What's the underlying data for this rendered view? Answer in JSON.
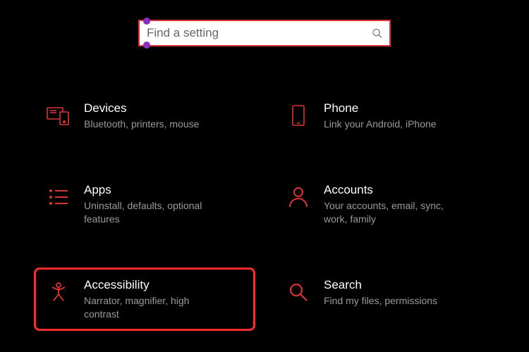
{
  "search": {
    "placeholder": "Find a setting",
    "value": ""
  },
  "tiles": {
    "devices": {
      "title": "Devices",
      "desc": "Bluetooth, printers, mouse"
    },
    "phone": {
      "title": "Phone",
      "desc": "Link your Android, iPhone"
    },
    "apps": {
      "title": "Apps",
      "desc": "Uninstall, defaults, optional features"
    },
    "accounts": {
      "title": "Accounts",
      "desc": "Your accounts, email, sync, work, family"
    },
    "accessibility": {
      "title": "Accessibility",
      "desc": "Narrator, magnifier, high contrast"
    },
    "search": {
      "title": "Search",
      "desc": "Find my files, permissions"
    }
  },
  "colors": {
    "accent": "#d93434",
    "highlight_border": "#ff2a2a",
    "bg": "#000000",
    "text": "#ffffff",
    "muted": "#9a9a9a"
  }
}
